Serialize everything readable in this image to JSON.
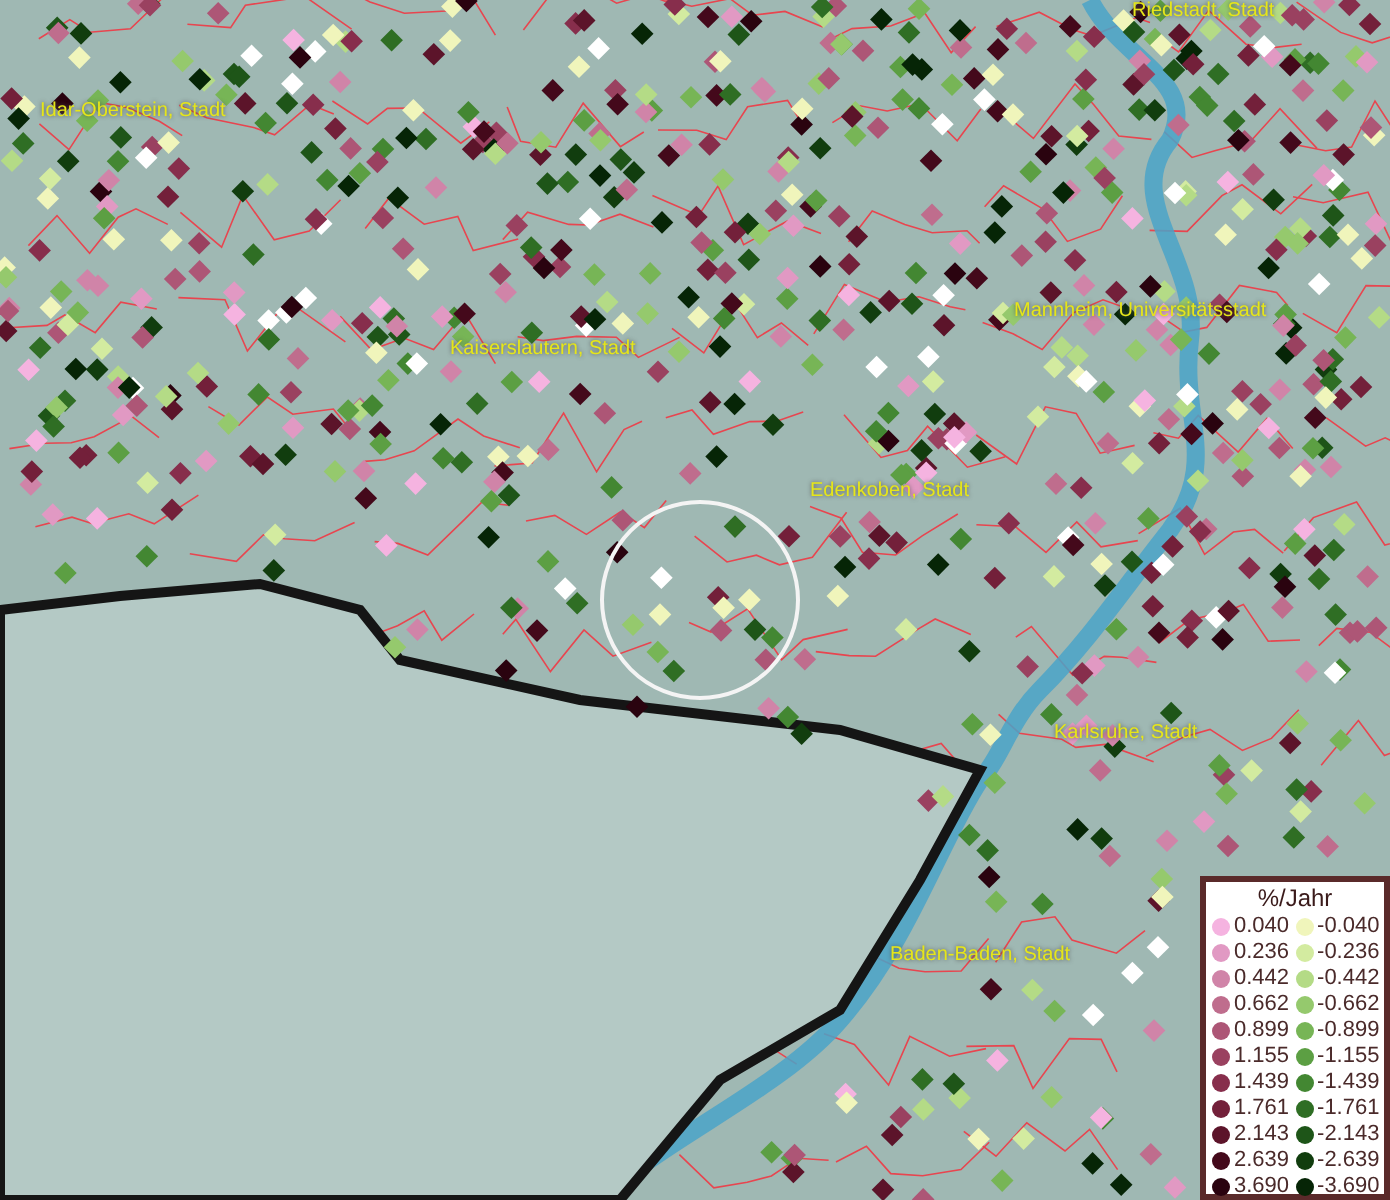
{
  "map": {
    "cities": [
      {
        "name": "Riedstadt, Stadt"
      },
      {
        "name": "Idar-Oberstein, Stadt"
      },
      {
        "name": "Mannheim, Universitätsstadt"
      },
      {
        "name": "Kaiserslautern, Stadt"
      },
      {
        "name": "Edenkoben, Stadt"
      },
      {
        "name": "Karlsruhe, Stadt"
      },
      {
        "name": "Baden-Baden, Stadt"
      }
    ],
    "legend": {
      "title": "%/Jahr",
      "columns": [
        {
          "items": [
            {
              "label": "0.040",
              "color": "#f5b3e0"
            },
            {
              "label": "0.236",
              "color": "#e199c3"
            },
            {
              "label": "0.442",
              "color": "#d084a8"
            },
            {
              "label": "0.662",
              "color": "#bf6d8d"
            },
            {
              "label": "0.899",
              "color": "#ad5676"
            },
            {
              "label": "1.155",
              "color": "#9a4160"
            },
            {
              "label": "1.439",
              "color": "#872e4c"
            },
            {
              "label": "1.761",
              "color": "#73203a"
            },
            {
              "label": "2.143",
              "color": "#5c142a"
            },
            {
              "label": "2.639",
              "color": "#44091b"
            },
            {
              "label": "3.690",
              "color": "#2a030f"
            }
          ]
        },
        {
          "items": [
            {
              "label": "-0.040",
              "color": "#f0f5bb"
            },
            {
              "label": "-0.236",
              "color": "#d3eba0"
            },
            {
              "label": "-0.442",
              "color": "#b4db86"
            },
            {
              "label": "-0.662",
              "color": "#95c96d"
            },
            {
              "label": "-0.899",
              "color": "#77b556"
            },
            {
              "label": "-1.155",
              "color": "#5c9f43"
            },
            {
              "label": "-1.439",
              "color": "#438732"
            },
            {
              "label": "-1.761",
              "color": "#2f6e24"
            },
            {
              "label": "-2.143",
              "color": "#1e5518"
            },
            {
              "label": "-2.639",
              "color": "#113d0e"
            },
            {
              "label": "-3.690",
              "color": "#062506"
            }
          ]
        }
      ]
    }
  }
}
